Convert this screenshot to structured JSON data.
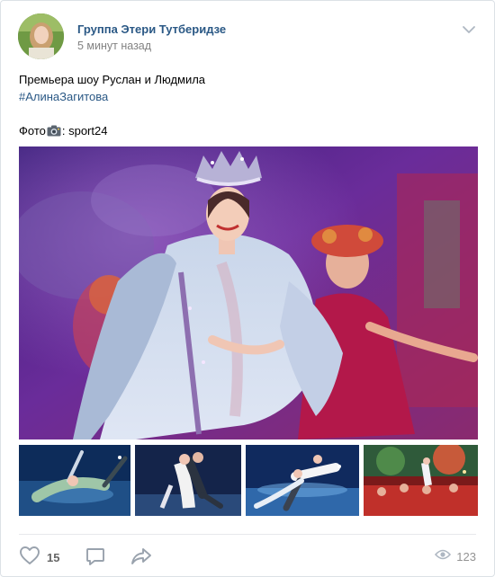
{
  "post": {
    "author": "Группа Этери Тутберидзе",
    "time": "5 минут назад",
    "text_line1": "Премьера шоу Руслан и Людмила",
    "hashtag": "#АлинаЗагитова",
    "photo_prefix": "Фото",
    "photo_suffix": ": sport24"
  },
  "actions": {
    "likes": "15",
    "views": "123"
  },
  "icons": {
    "menu": "chevron-down-icon",
    "like": "heart-icon",
    "comment": "comment-icon",
    "share": "share-icon",
    "views": "eye-icon",
    "camera": "camera-icon"
  },
  "colors": {
    "link": "#2a5885",
    "muted": "#828282",
    "icon": "#99a2ad"
  }
}
